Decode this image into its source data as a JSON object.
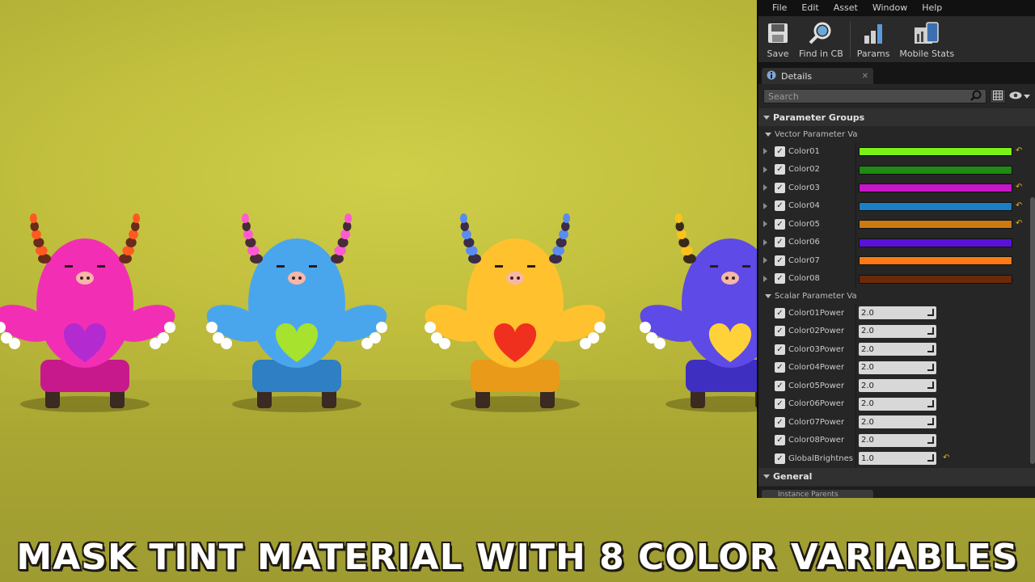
{
  "menu": [
    "File",
    "Edit",
    "Asset",
    "Window",
    "Help"
  ],
  "toolbar": [
    {
      "label": "Save",
      "icon": "save-icon"
    },
    {
      "label": "Find in CB",
      "icon": "magnifier-icon"
    },
    {
      "label": "Params",
      "icon": "params-icon"
    },
    {
      "label": "Mobile Stats",
      "icon": "mobile-stats-icon"
    }
  ],
  "details_tab": {
    "label": "Details"
  },
  "search": {
    "placeholder": "Search"
  },
  "parameter_groups": {
    "label": "Parameter Groups"
  },
  "vector_group": {
    "label": "Vector Parameter Va"
  },
  "vector_params": [
    {
      "name": "Color01",
      "color": "#7cf01a",
      "reset": true
    },
    {
      "name": "Color02",
      "color": "#1e8a14",
      "reset": false
    },
    {
      "name": "Color03",
      "color": "#c715c7",
      "reset": true
    },
    {
      "name": "Color04",
      "color": "#1a7fc7",
      "reset": true
    },
    {
      "name": "Color05",
      "color": "#cc7a10",
      "reset": true
    },
    {
      "name": "Color06",
      "color": "#5a12d8",
      "reset": false
    },
    {
      "name": "Color07",
      "color": "#ff7a12",
      "reset": false
    },
    {
      "name": "Color08",
      "color": "#6a2a08",
      "reset": false
    }
  ],
  "scalar_group": {
    "label": "Scalar Parameter Va"
  },
  "scalar_params": [
    {
      "name": "Color01Power",
      "value": "2.0",
      "reset": false
    },
    {
      "name": "Color02Power",
      "value": "2.0",
      "reset": false
    },
    {
      "name": "Color03Power",
      "value": "2.0",
      "reset": false
    },
    {
      "name": "Color04Power",
      "value": "2.0",
      "reset": false
    },
    {
      "name": "Color05Power",
      "value": "2.0",
      "reset": false
    },
    {
      "name": "Color06Power",
      "value": "2.0",
      "reset": false
    },
    {
      "name": "Color07Power",
      "value": "2.0",
      "reset": false
    },
    {
      "name": "Color08Power",
      "value": "2.0",
      "reset": false
    },
    {
      "name": "GlobalBrightnes",
      "value": "1.0",
      "reset": true
    }
  ],
  "general": {
    "label": "General"
  },
  "instance_parents": {
    "label": "Instance Parents"
  },
  "caption": "MASK TINT MATERIAL WITH 8 COLOR VARIABLES",
  "monsters": [
    {
      "body": "#f22fb4",
      "shade": "#c8198c",
      "horn1": "#6b2a1a",
      "horn2": "#ff5a20",
      "heart": "#b32ad0"
    },
    {
      "body": "#4aa6ec",
      "shade": "#2e7fc4",
      "horn1": "#4a2a3a",
      "horn2": "#ff5ad2",
      "heart": "#a6e22e"
    },
    {
      "body": "#ffc12e",
      "shade": "#e89a18",
      "horn1": "#3a2c4a",
      "horn2": "#5a8cf0",
      "heart": "#f0301e"
    },
    {
      "body": "#5e4ae6",
      "shade": "#3e2fc0",
      "horn1": "#3a2a1a",
      "horn2": "#ffc21a",
      "heart": "#ffd23a"
    }
  ]
}
